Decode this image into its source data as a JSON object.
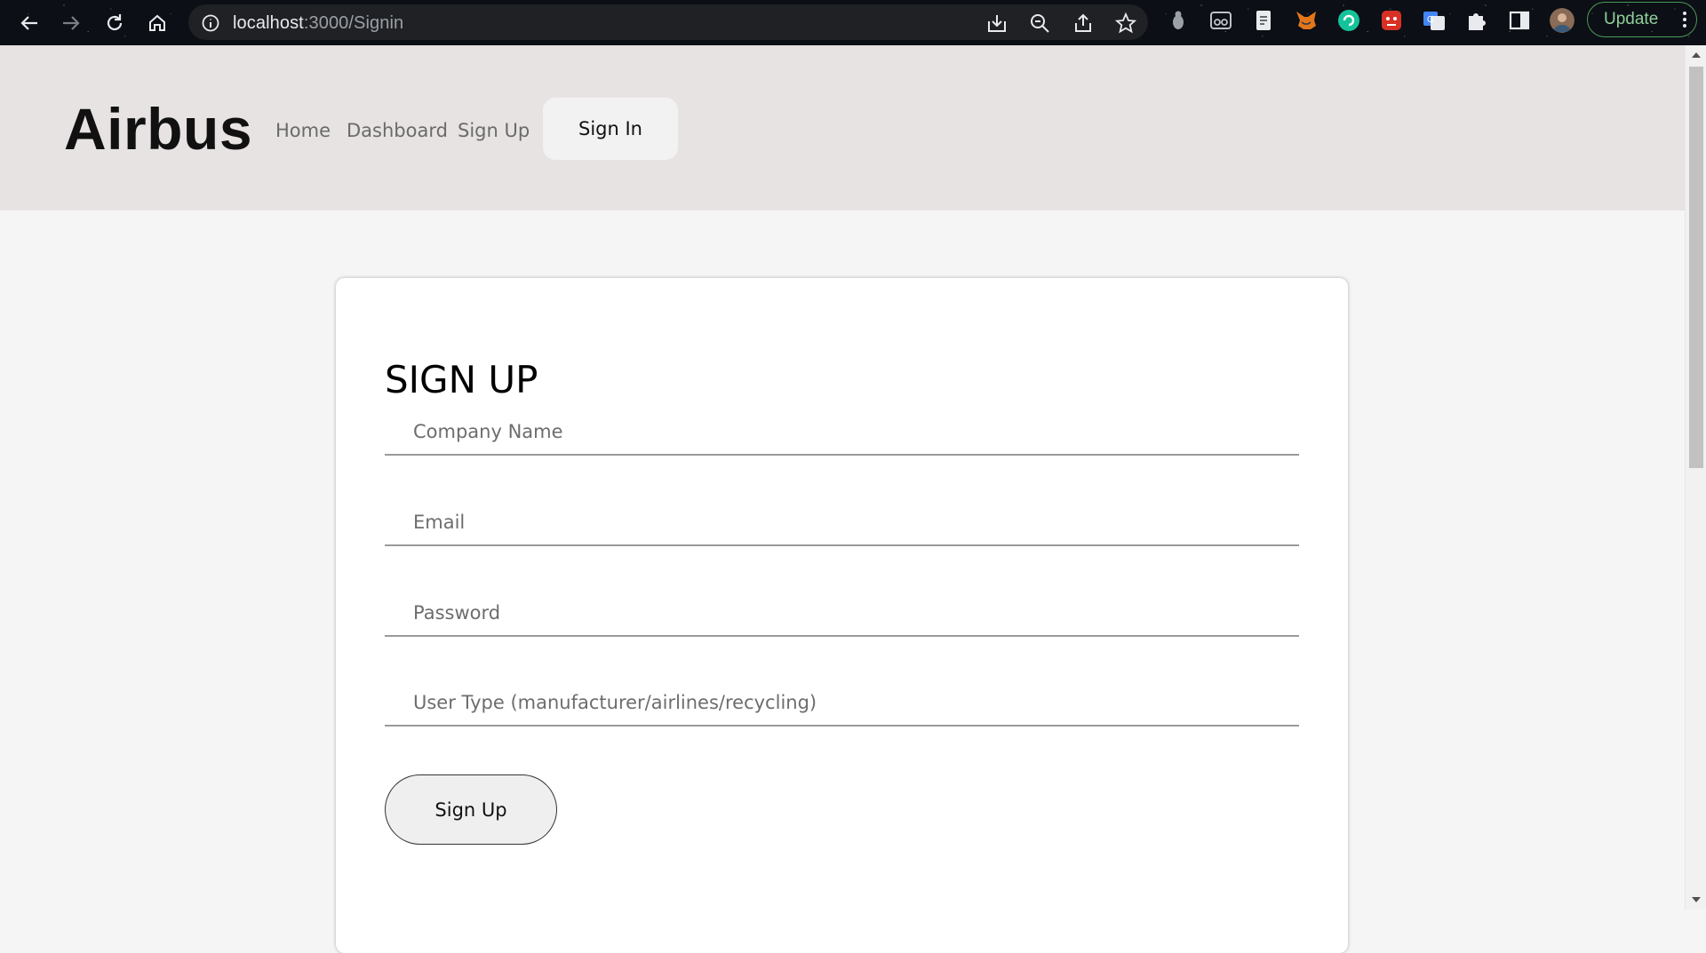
{
  "browser": {
    "url_host": "localhost",
    "url_path": ":3000/Signin",
    "update_label": "Update"
  },
  "header": {
    "brand": "Airbus",
    "nav": [
      "Home",
      "Dashboard",
      "Sign Up"
    ],
    "signin_label": "Sign In"
  },
  "form": {
    "title": "SIGN UP",
    "fields": {
      "company": "Company Name",
      "email": "Email",
      "password": "Password",
      "user_type": "User Type (manufacturer/airlines/recycling)"
    },
    "submit_label": "Sign Up"
  },
  "colors": {
    "header_bg": "#e8e3e3",
    "page_bg": "#f6f5f5",
    "update_accent": "#4b9b57"
  }
}
